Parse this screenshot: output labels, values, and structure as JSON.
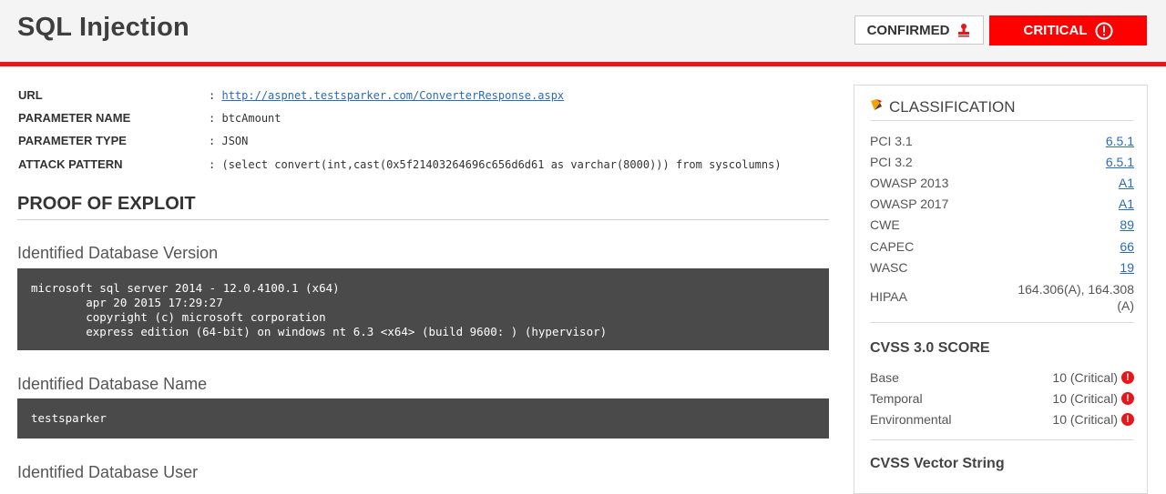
{
  "header": {
    "title": "SQL Injection",
    "confirmed_label": "CONFIRMED",
    "critical_label": "CRITICAL",
    "accent_color": "#e8161a"
  },
  "info": {
    "url_label": "URL",
    "url_value": "http://aspnet.testsparker.com/ConverterResponse.aspx",
    "param_name_label": "PARAMETER NAME",
    "param_name_value": "btcAmount",
    "param_type_label": "PARAMETER TYPE",
    "param_type_value": "JSON",
    "attack_label": "ATTACK PATTERN",
    "attack_value": "(select convert(int,cast(0x5f21403264696c656d6d61 as varchar(8000))) from syscolumns)",
    "separator": ":"
  },
  "proof": {
    "title": "PROOF OF EXPLOIT",
    "db_version_title": "Identified Database Version",
    "db_version_lines": [
      "microsoft sql server 2014 - 12.0.4100.1 (x64)",
      "        apr 20 2015 17:29:27",
      "        copyright (c) microsoft corporation",
      "        express edition (64-bit) on windows nt 6.3 <x64> (build 9600: ) (hypervisor)"
    ],
    "db_name_title": "Identified Database Name",
    "db_name_value": "testsparker",
    "db_user_title": "Identified Database User"
  },
  "classification": {
    "title": "CLASSIFICATION",
    "items": [
      {
        "key": "PCI 3.1",
        "value": "6.5.1"
      },
      {
        "key": "PCI 3.2",
        "value": "6.5.1"
      },
      {
        "key": "OWASP 2013",
        "value": "A1"
      },
      {
        "key": "OWASP 2017",
        "value": "A1"
      },
      {
        "key": "CWE",
        "value": "89"
      },
      {
        "key": "CAPEC",
        "value": "66"
      },
      {
        "key": "WASC",
        "value": "19"
      }
    ],
    "hipaa_key": "HIPAA",
    "hipaa_value": "164.306(A), 164.308 (A)"
  },
  "cvss": {
    "title": "CVSS 3.0 SCORE",
    "items": [
      {
        "key": "Base",
        "value": "10 (Critical)"
      },
      {
        "key": "Temporal",
        "value": "10 (Critical)"
      },
      {
        "key": "Environmental",
        "value": "10 (Critical)"
      }
    ],
    "vector_title": "CVSS Vector String"
  }
}
